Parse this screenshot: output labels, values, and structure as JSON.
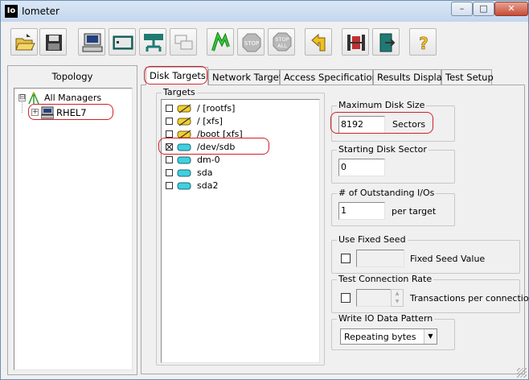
{
  "window": {
    "app_icon_text": "Io",
    "title": "Iometer",
    "minimize": "–",
    "maximize": "□",
    "close": "✕"
  },
  "toolbar": {
    "buttons": [
      {
        "name": "open-config-button",
        "icon": "folder-open-icon"
      },
      {
        "name": "save-config-button",
        "icon": "floppy-disk-icon"
      },
      {
        "name": "new-disk-worker-button",
        "icon": "computer-icon"
      },
      {
        "name": "new-network-worker-button",
        "icon": "network-card-icon"
      },
      {
        "name": "duplicate-worker-button",
        "icon": "network-worker-icon"
      },
      {
        "name": "disconnect-button",
        "icon": "copy-windows-icon"
      },
      {
        "name": "start-tests-button",
        "icon": "green-flag-icon"
      },
      {
        "name": "stop-button",
        "icon": "stop-sign-icon",
        "text": "STOP"
      },
      {
        "name": "stop-all-button",
        "icon": "stop-all-icon",
        "text": "STOP",
        "text2": "ALL"
      },
      {
        "name": "reset-workers-button",
        "icon": "reset-arrow-icon"
      },
      {
        "name": "new-manager-button",
        "icon": "red-bars-icon"
      },
      {
        "name": "exit-button",
        "icon": "exit-door-icon"
      },
      {
        "name": "help-button",
        "icon": "question-mark-icon",
        "text": "?"
      }
    ]
  },
  "topology": {
    "title": "Topology",
    "tree": [
      {
        "label": "All Managers",
        "expander": "⊟",
        "icon": "managers-network-icon"
      },
      {
        "label": "RHEL7",
        "expander": "+",
        "icon": "computer-icon"
      }
    ]
  },
  "tabs": [
    {
      "label": "Disk Targets",
      "active": true
    },
    {
      "label": "Network Targets",
      "active": false
    },
    {
      "label": "Access Specifications",
      "active": false
    },
    {
      "label": "Results Display",
      "active": false
    },
    {
      "label": "Test Setup",
      "active": false
    }
  ],
  "targets": {
    "title": "Targets",
    "items": [
      {
        "label": "/ [rootfs]",
        "checked": false,
        "icon": "yellow-disk-slash-icon"
      },
      {
        "label": "/ [xfs]",
        "checked": false,
        "icon": "yellow-disk-slash-icon"
      },
      {
        "label": "/boot [xfs]",
        "checked": false,
        "icon": "yellow-disk-slash-icon"
      },
      {
        "label": "/dev/sdb",
        "checked": true,
        "icon": "cyan-disk-icon"
      },
      {
        "label": "dm-0",
        "checked": false,
        "icon": "cyan-disk-icon"
      },
      {
        "label": "sda",
        "checked": false,
        "icon": "cyan-disk-icon"
      },
      {
        "label": "sda2",
        "checked": false,
        "icon": "cyan-disk-icon"
      }
    ]
  },
  "max_disk_size": {
    "title": "Maximum Disk Size",
    "value": "8192",
    "unit": "Sectors"
  },
  "starting_sector": {
    "title": "Starting Disk Sector",
    "value": "0"
  },
  "outstanding_ios": {
    "title": "# of Outstanding I/Os",
    "value": "1",
    "unit": "per target"
  },
  "fixed_seed": {
    "title": "Use Fixed Seed",
    "label": "Fixed Seed Value",
    "value": ""
  },
  "test_connection": {
    "title": "Test Connection Rate",
    "label": "Transactions per connection",
    "value": ""
  },
  "io_pattern": {
    "title": "Write IO Data Pattern",
    "value": "Repeating bytes"
  },
  "colors": {
    "annotation": "#d0202a",
    "active_tab": "#ffffff",
    "window_bg": "#f0f0f0"
  }
}
